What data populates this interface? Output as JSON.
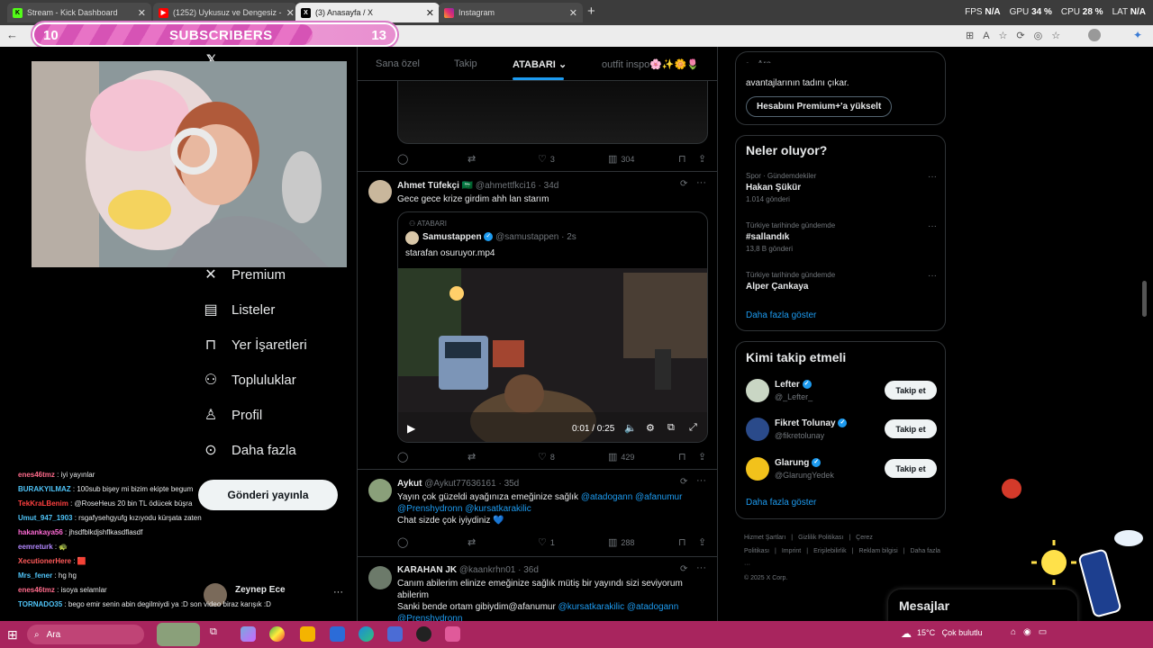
{
  "browser": {
    "tabs": [
      {
        "label": "Stream - Kick Dashboard",
        "icon": "kick-icon",
        "color": "#53fc18"
      },
      {
        "label": "(1252) Uykusuz ve Dengesiz -",
        "icon": "youtube-icon",
        "color": "#ff0000"
      },
      {
        "label": "(3) Anasayfa / X",
        "icon": "x-icon",
        "color": "#ffffff"
      },
      {
        "label": "Instagram",
        "icon": "instagram-icon",
        "color": "#e1306c"
      }
    ],
    "new_tab": "+",
    "close": "✕"
  },
  "perf": {
    "fps_label": "FPS",
    "fps_value": "N/A",
    "gpu_label": "GPU",
    "gpu_value": "34 %",
    "cpu_label": "CPU",
    "cpu_value": "28 %",
    "lat_label": "LAT",
    "lat_value": "N/A"
  },
  "overlay": {
    "sub_left": "10",
    "sub_title": "SUBSCRIBERS",
    "sub_right": "13",
    "sub_progress": 0.77
  },
  "nav": {
    "items": [
      {
        "label": "Premium",
        "icon": "x-logo-icon"
      },
      {
        "label": "Listeler",
        "icon": "list-icon"
      },
      {
        "label": "Yer İşaretleri",
        "icon": "bookmark-icon"
      },
      {
        "label": "Topluluklar",
        "icon": "communities-icon"
      },
      {
        "label": "Profil",
        "icon": "profile-icon"
      },
      {
        "label": "Daha fazla",
        "icon": "more-icon"
      }
    ],
    "post_button": "Gönderi yayınla",
    "account_name": "Zeynep Ece"
  },
  "chat": [
    {
      "user": "enes46tmz",
      "color": "#ff6b8b",
      "msg": " : iyi yayınlar"
    },
    {
      "user": "BURAKYILMAZ",
      "color": "#4fc3f7",
      "msg": " : 100sub bişey mi bizim ekipte begum"
    },
    {
      "user": "TekKraLBenim",
      "color": "#ff4040",
      "msg": " : @RoseHeus 20 bin TL ödücek büşra"
    },
    {
      "user": "Umut_947_1903",
      "color": "#4fc3f7",
      "msg": " : rsgafysehgyufg kızıyodu kürşata zaten"
    },
    {
      "user": "hakankaya56",
      "color": "#ff6bd6",
      "msg": " : jhsdfblkdjshflkasdflasdf"
    },
    {
      "user": "eemreturk",
      "color": "#b388ff",
      "msg": " : 🐢"
    },
    {
      "user": "XecutionerHere",
      "color": "#ff5a5a",
      "msg": " : 🟥"
    },
    {
      "user": "Mrs_fener",
      "color": "#4fc3f7",
      "msg": " : hg hg"
    },
    {
      "user": "enes46tmz",
      "color": "#ff6b8b",
      "msg": " : isoya selamlar"
    },
    {
      "user": "TORNADO35",
      "color": "#4fc3f7",
      "msg": " : bego emir senin abin degilmiydi ya :D son video biraz karışık :D"
    }
  ],
  "timeline": {
    "tabs": [
      "Sana özel",
      "Takip",
      "ATABARI",
      "outfit inspo🌸✨🌼🌷"
    ],
    "selected_tab": "ATABARI",
    "first_actions": {
      "likes": "3",
      "views": "304"
    },
    "tweets": [
      {
        "name": "Ahmet Tüfekçi 🇸🇦",
        "handle": "@ahmettfkci16 · 34d",
        "text": "Gece gece krize girdim ahh lan starım",
        "quote_community": "ATABARI",
        "quote_name": "Samustappen",
        "quote_handle": "@samustappen · 2s",
        "quote_text": "starafan osuruyor.mp4",
        "video_time": "0:01 / 0:25",
        "likes": "8",
        "views": "429"
      },
      {
        "name": "Aykut",
        "handle": "@Aykut77636161 · 35d",
        "text_parts": [
          "Yayın çok güzeldi ayağınıza emeğinize sağlık ",
          "@atadogann @afanumur",
          " ",
          "@Prenshydronn @kursatkarakilic"
        ],
        "text2": "Chat sizde çok iyiydiniz 💙",
        "likes": "1",
        "views": "288"
      },
      {
        "name": "KARAHAN JK",
        "handle": "@kaankrhn01 · 36d",
        "text1": "Canım abilerim elinize emeğinize sağlık mütiş bir yayındı  sizi seviyorum abilerim",
        "text2a": " Sanki bende ortam gibiydim@afanumur ",
        "text2b": "@kursatkarakilic @atadogann",
        "text3": "@Prenshydronn"
      }
    ]
  },
  "right": {
    "search_placeholder": "Ara",
    "premium_text": "avantajlarının tadını çıkar.",
    "premium_button": "Hesabını Premium+'a yükselt",
    "trends_title": "Neler oluyor?",
    "trends": [
      {
        "cat": "Spor · Gündemdekiler",
        "title": "Hakan Şükür",
        "count": "1.014 gönderi"
      },
      {
        "cat": "Türkiye tarihinde gündemde",
        "title": "#sallandık",
        "count": "13,8 B gönderi"
      },
      {
        "cat": "Türkiye tarihinde gündemde",
        "title": "Alper Çankaya",
        "count": ""
      }
    ],
    "show_more": "Daha fazla göster",
    "wtf_title": "Kimi takip etmeli",
    "wtf": [
      {
        "name": "Lefter",
        "handle": "@_Lefter_",
        "button": "Takip et",
        "avatar_color": "#c9d6c4"
      },
      {
        "name": "Fikret Tolunay",
        "handle": "@fikretolunay",
        "button": "Takip et",
        "avatar_color": "#2a4a8a"
      },
      {
        "name": "Glarung",
        "handle": "@GlarungYedek",
        "button": "Takip et",
        "avatar_color": "#f2c21b"
      }
    ],
    "wtf_show_more": "Daha fazla göster",
    "footer_links": [
      "Hizmet Şartları",
      "|",
      "Gizlilik Politikası",
      "|",
      "Çerez Politikası",
      "|",
      "Imprint",
      "|",
      "Erişilebilirlik",
      "|",
      "Reklam bilgisi",
      "|",
      "Daha fazla ···"
    ],
    "copyright": "© 2025 X Corp.",
    "messages": "Mesajlar"
  },
  "taskbar": {
    "search": "Ara",
    "temperature": "15°C",
    "weather": "Çok bulutlu"
  }
}
